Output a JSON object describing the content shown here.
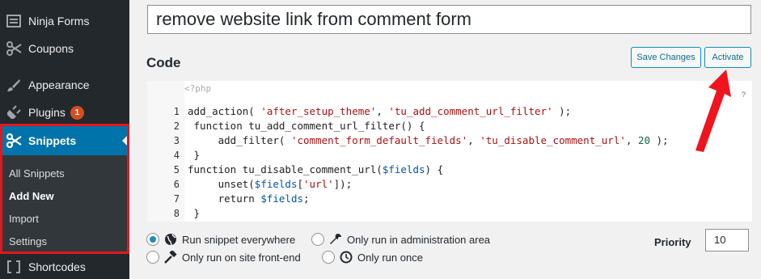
{
  "sidebar": {
    "items": [
      {
        "label": "Ninja Forms",
        "icon": "form-icon"
      },
      {
        "label": "Coupons",
        "icon": "scissors-icon"
      },
      {
        "label": "Appearance",
        "icon": "paintbrush-icon"
      },
      {
        "label": "Plugins",
        "icon": "plug-icon",
        "badge": "1"
      },
      {
        "label": "Shortcodes",
        "icon": "brackets-icon"
      }
    ],
    "snippets": {
      "label": "Snippets",
      "icon": "scissors-icon",
      "submenu": [
        {
          "label": "All Snippets"
        },
        {
          "label": "Add New",
          "current": true
        },
        {
          "label": "Import"
        },
        {
          "label": "Settings"
        }
      ]
    }
  },
  "snippet": {
    "title": "remove website link from comment form",
    "code_heading": "Code",
    "save_label": "Save Changes",
    "activate_label": "Activate",
    "php_tag": "<?php",
    "help": "?",
    "line_numbers": [
      "1",
      "2",
      "3",
      "4",
      "5",
      "6",
      "7",
      "8"
    ]
  },
  "scope_options": [
    {
      "label": "Run snippet everywhere",
      "icon": "globe-icon",
      "checked": true
    },
    {
      "label": "Only run in administration area",
      "icon": "wrench-icon",
      "checked": false
    },
    {
      "label": "Only run on site front-end",
      "icon": "hammer-icon",
      "checked": false
    },
    {
      "label": "Only run once",
      "icon": "clock-icon",
      "checked": false
    }
  ],
  "priority": {
    "label": "Priority",
    "value": "10"
  },
  "colors": {
    "accent": "#0073aa",
    "highlight_border": "#e0181f",
    "arrow": "#f0141e"
  }
}
